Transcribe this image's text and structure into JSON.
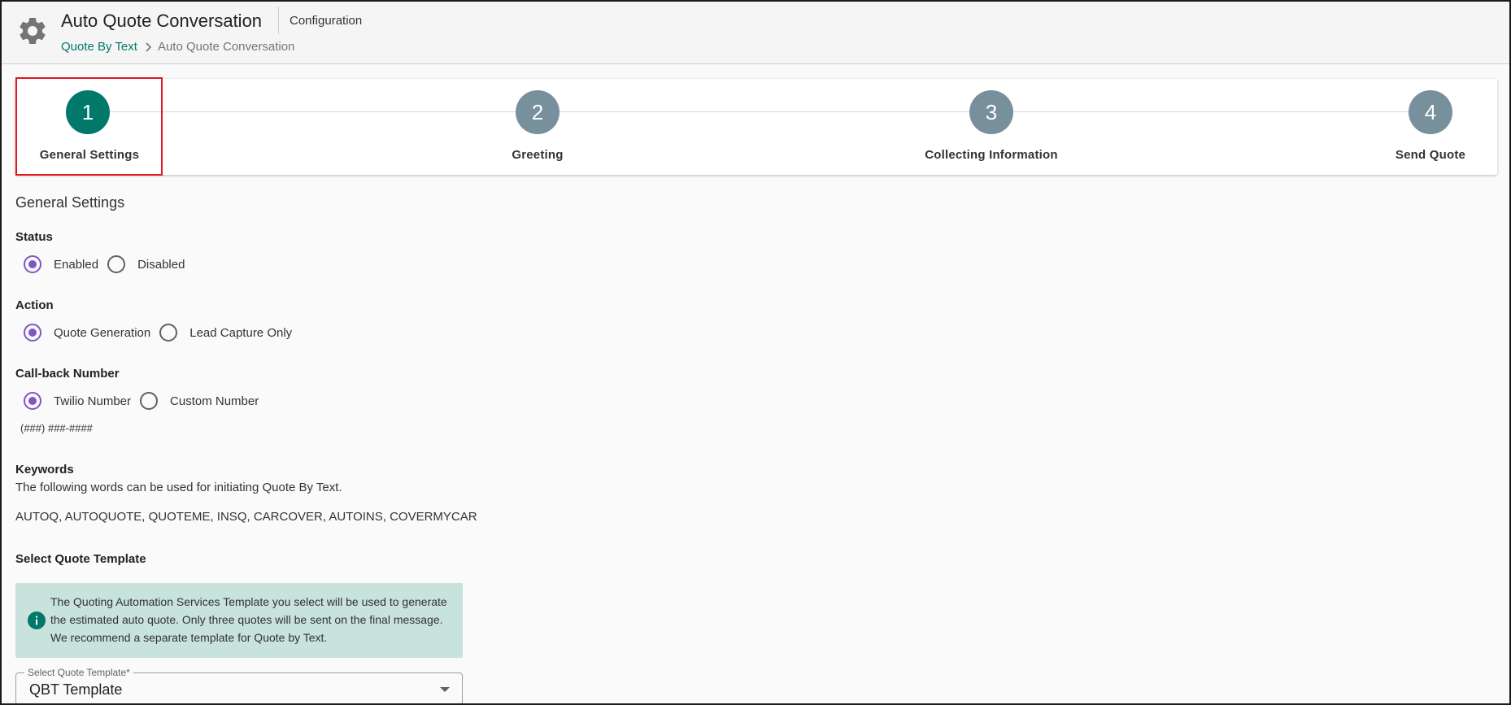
{
  "header": {
    "title": "Auto Quote Conversation",
    "section": "Configuration",
    "breadcrumb": {
      "parent": "Quote By Text",
      "current": "Auto Quote Conversation"
    },
    "icon": "gear-icon"
  },
  "stepper": {
    "steps": [
      {
        "number": "1",
        "label": "General Settings",
        "active": true
      },
      {
        "number": "2",
        "label": "Greeting",
        "active": false
      },
      {
        "number": "3",
        "label": "Collecting Information",
        "active": false
      },
      {
        "number": "4",
        "label": "Send Quote",
        "active": false
      }
    ],
    "colors": {
      "active": "#00796b",
      "inactive": "#78909c",
      "highlight": "#e0181f"
    }
  },
  "general": {
    "title": "General Settings",
    "status": {
      "label": "Status",
      "options": [
        "Enabled",
        "Disabled"
      ],
      "selected": "Enabled"
    },
    "action": {
      "label": "Action",
      "options": [
        "Quote Generation",
        "Lead Capture Only"
      ],
      "selected": "Quote Generation"
    },
    "callback": {
      "label": "Call-back Number",
      "options": [
        "Twilio Number",
        "Custom Number"
      ],
      "selected": "Twilio Number",
      "phone": "(###) ###-####"
    },
    "keywords": {
      "label": "Keywords",
      "description": "The following words can be used for initiating Quote By Text.",
      "list": "AUTOQ, AUTOQUOTE, QUOTEME, INSQ, CARCOVER, AUTOINS, COVERMYCAR"
    },
    "template": {
      "label": "Select Quote Template",
      "info": "The Quoting Automation Services Template you select will be used to generate the estimated auto quote. Only three quotes will be sent on the final message. We recommend a separate template for Quote by Text.",
      "field_label": "Select Quote Template*",
      "value": "QBT Template"
    }
  },
  "colors": {
    "accent": "#00796b",
    "radio": "#7e57c2",
    "info_bg": "#c8e2dc"
  }
}
